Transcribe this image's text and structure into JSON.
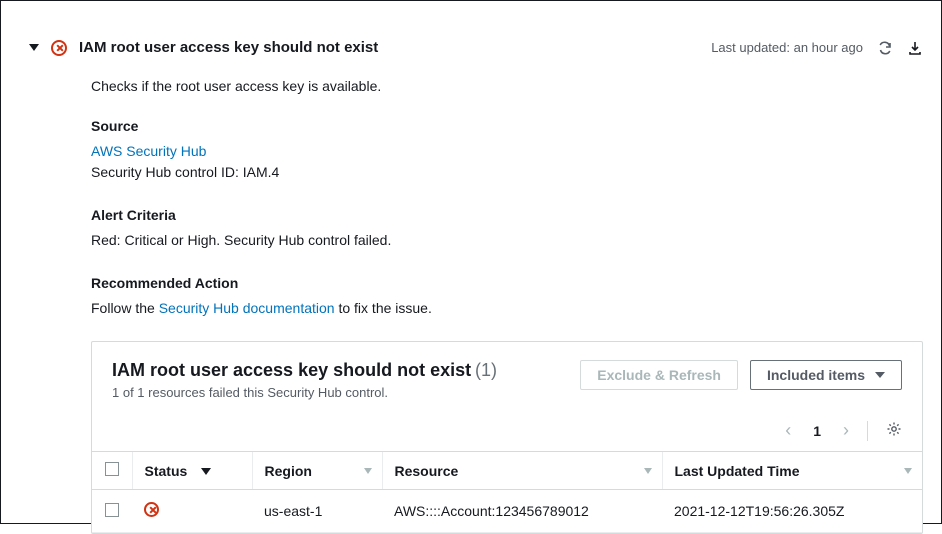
{
  "header": {
    "title": "IAM root user access key should not exist",
    "last_updated_label": "Last updated: an hour ago"
  },
  "details": {
    "description": "Checks if the root user access key is available.",
    "source_label": "Source",
    "source_link": "AWS Security Hub",
    "control_id_line": "Security Hub control ID: IAM.4",
    "criteria_label": "Alert Criteria",
    "criteria_text": "Red: Critical or High. Security Hub control failed.",
    "action_label": "Recommended Action",
    "action_prefix": "Follow the ",
    "action_link": "Security Hub documentation",
    "action_suffix": " to fix the issue."
  },
  "panel": {
    "title": "IAM root user access key should not exist",
    "count": "(1)",
    "subtitle": "1 of 1 resources failed this Security Hub control.",
    "exclude_btn": "Exclude & Refresh",
    "included_btn": "Included items",
    "page": "1"
  },
  "table": {
    "columns": {
      "status": "Status",
      "region": "Region",
      "resource": "Resource",
      "time": "Last Updated Time"
    },
    "row": {
      "region": "us-east-1",
      "resource": "AWS::::Account:123456789012",
      "time": "2021-12-12T19:56:26.305Z"
    }
  }
}
